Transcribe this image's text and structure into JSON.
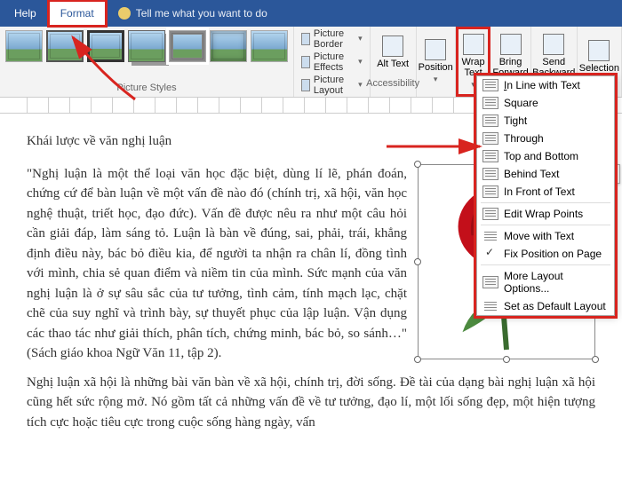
{
  "tabs": {
    "help": "Help",
    "format": "Format",
    "tellme": "Tell me what you want to do"
  },
  "ribbon": {
    "picture_styles": "Picture Styles",
    "picture_border": "Picture Border",
    "picture_effects": "Picture Effects",
    "picture_layout": "Picture Layout",
    "alt_text": "Alt Text",
    "accessibility": "Accessibility",
    "position": "Position",
    "wrap_text": "Wrap Text",
    "bring_forward": "Bring Forward",
    "send_backward": "Send Backward",
    "selection_pane": "Selection Pane"
  },
  "wrap_menu": {
    "inline": "In Line with Text",
    "square": "Square",
    "tight": "Tight",
    "through": "Through",
    "top_bottom": "Top and Bottom",
    "behind": "Behind Text",
    "front": "In Front of Text",
    "edit_points": "Edit Wrap Points",
    "move_with": "Move with Text",
    "fix_position": "Fix Position on Page",
    "more_options": "More Layout Options...",
    "set_default": "Set as Default Layout"
  },
  "doc": {
    "heading": "Khái lược về văn nghị luận",
    "left": "\"Nghị luận là một thể loại văn học đặc biệt, dùng lí lẽ, phán đoán, chứng cứ để bàn luận về một vấn đề nào đó (chính trị, xã hội, văn học nghệ thuật, triết học, đạo đức). Vấn đề được nêu ra như một câu hỏi cần giải đáp, làm sáng tỏ. Luận là bàn về đúng, sai, phải, trái, khẳng định điều này, bác bỏ điều kia, để người ta nhận ra chân lí, đồng tình với mình, chia sẻ quan điểm và niềm tin của mình. Sức mạnh của văn nghị luận là ở sự sâu sắc của tư tưởng, tình cảm, tính mạch lạc, chặt chẽ của suy nghĩ và trình bày, sự thuyết phục của lập luận. Vận dụng các thao tác như giải thích, phân tích, chứng minh, bác bỏ, so sánh…\" (Sách giáo khoa Ngữ Văn 11, tập 2).",
    "para2": "Nghị luận xã hội là những bài văn bàn về xã hội, chính trị, đời sống. Đề tài của dạng bài nghị luận xã hội cũng hết sức rộng mở. Nó gồm tất cả những vấn đề về tư tưởng, đạo lí, một lối sống đẹp, một hiện tượng tích cực hoặc tiêu cực trong cuộc sống hàng ngày, vấn"
  }
}
